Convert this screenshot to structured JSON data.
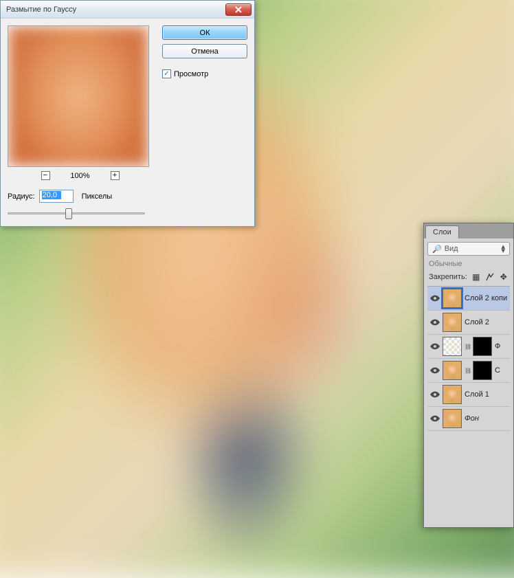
{
  "dialog": {
    "title": "Размытие по Гауссу",
    "ok": "ОК",
    "cancel": "Отмена",
    "preview_checkbox": "Просмотр",
    "zoom_pct": "100%",
    "minus": "−",
    "plus": "+",
    "radius_label": "Радиус:",
    "radius_value": "20,0",
    "unit": "Пикселы"
  },
  "panel": {
    "tab": "Слои",
    "kind_search": "Вид",
    "blend_mode": "Обычные",
    "lock_label": "Закрепить:",
    "layers": [
      {
        "name": "Слой 2 копи",
        "thumb": "photo",
        "selected": true
      },
      {
        "name": "Слой 2",
        "thumb": "photo"
      },
      {
        "name": "Ф",
        "thumb": "bokeh",
        "mask": true
      },
      {
        "name": "С",
        "thumb": "photo",
        "mask": true
      },
      {
        "name": "Слой 1",
        "thumb": "photo"
      },
      {
        "name": "Фон",
        "thumb": "photo",
        "italic": true
      }
    ]
  }
}
